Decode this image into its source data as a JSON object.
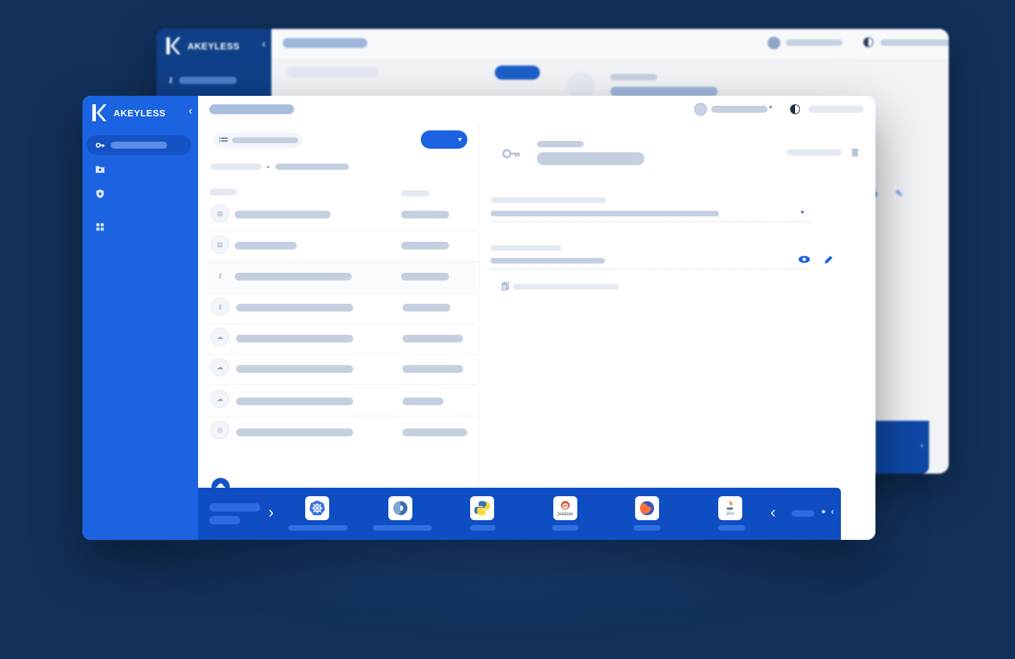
{
  "app": {
    "brand": "AKEYLESS",
    "accent_color": "#1b63e0",
    "sidebar_color": "#1b63e0",
    "background_color": "#12305a"
  },
  "sidebar": {
    "items": [
      {
        "icon": "key-icon",
        "active": true
      },
      {
        "icon": "folder-icon",
        "active": false
      },
      {
        "icon": "shield-icon",
        "active": false
      },
      {
        "icon": "grid-icon",
        "active": false
      }
    ]
  },
  "header": {
    "avatar_icon": "user-avatar-icon",
    "theme_icon": "contrast-icon"
  },
  "list": {
    "new_button_icon": "chevron-down-icon",
    "filter_icon": "list-icon",
    "rows": [
      {
        "icon": "folder-icon"
      },
      {
        "icon": "folder-icon"
      },
      {
        "icon": "key-icon"
      },
      {
        "icon": "key-icon"
      },
      {
        "icon": "cloud-icon"
      },
      {
        "icon": "cloud-icon"
      },
      {
        "icon": "cloud-icon"
      },
      {
        "icon": "target-icon"
      }
    ]
  },
  "detail": {
    "item_icon": "key-icon",
    "actions": [
      "view-icon",
      "edit-icon",
      "copy-icon",
      "delete-icon"
    ]
  },
  "integrations": {
    "tools": [
      {
        "icon": "kubernetes-icon"
      },
      {
        "icon": "circleci-icon"
      },
      {
        "icon": "python-icon"
      },
      {
        "icon": "jenkins-icon",
        "label": "Jenkins"
      },
      {
        "icon": "firefox-icon"
      },
      {
        "icon": "java-icon",
        "label": "java"
      }
    ]
  }
}
